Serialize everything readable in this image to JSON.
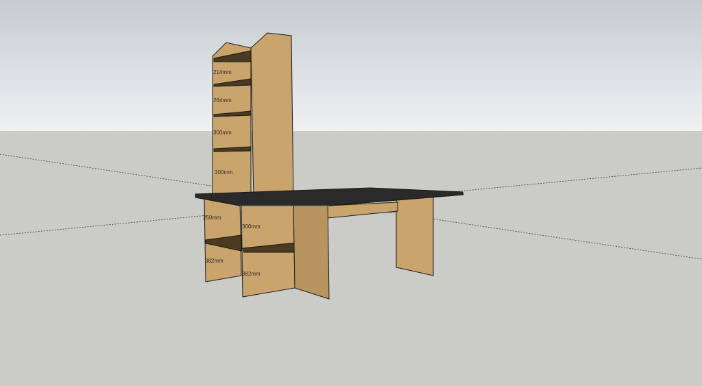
{
  "scene": {
    "colors": {
      "wood_light": "#c9a46c",
      "wood_mid": "#b8955f",
      "wood_dark": "#8c6d3d",
      "shelf_shadow": "#4a3a1f",
      "desktop": "#2a2a2a",
      "edge": "#1a1a1a",
      "sky": "#dfe3e6",
      "ground": "#cbccc7"
    },
    "dimensions": {
      "bookcase_shelf_1": "214mm",
      "bookcase_shelf_2": "264mm",
      "bookcase_shelf_3": "300mm",
      "bookcase_shelf_4": "300mm",
      "lower_left_upper": "250mm",
      "lower_left_lower": "382mm",
      "lower_right_upper": "300mm",
      "lower_right_lower": "382mm"
    },
    "objects": [
      "bookcase",
      "desktop",
      "lower-shelf-unit",
      "desk-leg"
    ]
  }
}
